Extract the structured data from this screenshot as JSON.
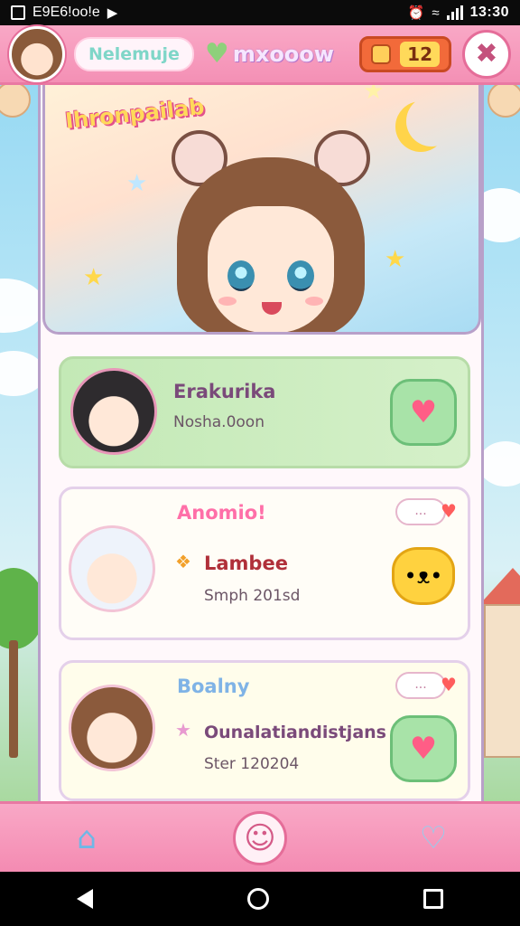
{
  "status_bar": {
    "left_text": "E9E6!oo!e",
    "time": "13:30"
  },
  "header": {
    "username": "Nelemuje",
    "logo_text": "mxooow",
    "coins": "12",
    "close_symbol": "✖"
  },
  "hero": {
    "title": "Ihronpailab"
  },
  "cards": [
    {
      "name": "Erakurika",
      "subtitle": "Nosha.0oon",
      "tag": "",
      "button_icon": "heart-icon"
    },
    {
      "name": "Lambee",
      "subtitle": "Smph 201sd",
      "tag": "Anomio!",
      "button_icon": "cat-icon"
    },
    {
      "name": "Ounalatiandistjans",
      "subtitle": "Ster 120204",
      "tag": "Boalny",
      "button_icon": "heart-icon"
    }
  ],
  "chat_bubble_text": "...",
  "icons": {
    "heart": "♥",
    "home": "⌂",
    "chat": "☺",
    "heart_outline": "♡",
    "star": "★",
    "cat": "•ᴥ•"
  },
  "colors": {
    "header_pink": "#f9a8c6",
    "accent_green": "#a8e3a8",
    "heart_pink": "#ff5d86"
  }
}
